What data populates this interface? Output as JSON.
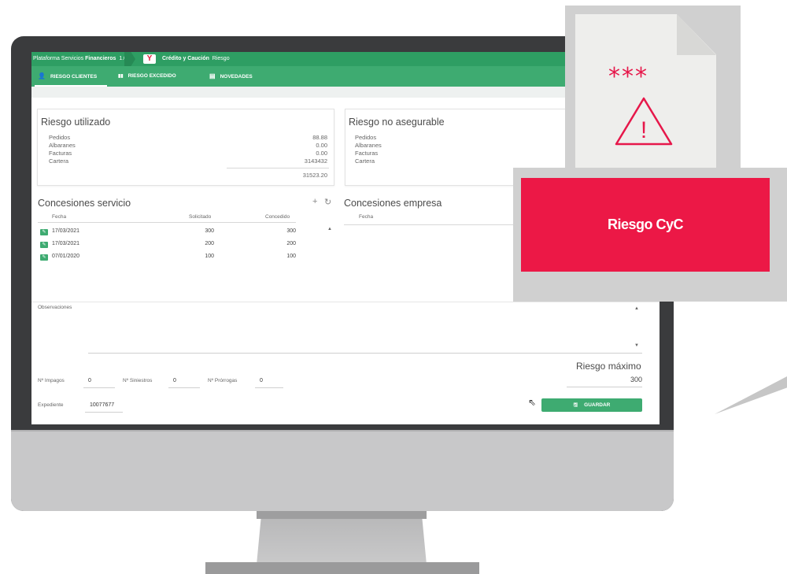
{
  "app": {
    "platform_name": "Plataforma Servicios ",
    "platform_bold": "Financieros",
    "version": "1.0",
    "breadcrumb_bold": "Crédito y Caución",
    "breadcrumb_rest": "Riesgo",
    "logo_glyph": "Y"
  },
  "tabs": [
    {
      "label": "RIESGO CLIENTES",
      "icon": "user-icon",
      "glyph": "👤",
      "active": true
    },
    {
      "label": "RIESGO EXCEDIDO",
      "icon": "bar-chart-icon",
      "glyph": "▮▮",
      "active": false
    },
    {
      "label": "NOVEDADES",
      "icon": "document-icon",
      "glyph": "▤",
      "active": false
    }
  ],
  "riesgo_utilizado": {
    "title": "Riesgo utilizado",
    "rows": [
      {
        "label": "Pedidos",
        "value": "88.88"
      },
      {
        "label": "Albaranes",
        "value": "0.00"
      },
      {
        "label": "Facturas",
        "value": "0.00"
      },
      {
        "label": "Cartera",
        "value": "3143432"
      }
    ],
    "total": "31523.20"
  },
  "riesgo_no_asegurable": {
    "title": "Riesgo no asegurable",
    "rows": [
      {
        "label": "Pedidos"
      },
      {
        "label": "Albaranes"
      },
      {
        "label": "Facturas"
      },
      {
        "label": "Cartera"
      }
    ]
  },
  "concesiones_servicio": {
    "title": "Concesiones servicio",
    "headers": {
      "fecha": "Fecha",
      "solicitado": "Solicitado",
      "concedido": "Concedido"
    },
    "rows": [
      {
        "fecha": "17/03/2021",
        "solicitado": "300",
        "concedido": "300"
      },
      {
        "fecha": "17/03/2021",
        "solicitado": "200",
        "concedido": "200"
      },
      {
        "fecha": "07/01/2020",
        "solicitado": "100",
        "concedido": "100"
      }
    ],
    "add_glyph": "+",
    "refresh_glyph": "↻",
    "scroll_up_glyph": "▲"
  },
  "concesiones_empresa": {
    "title": "Concesiones empresa",
    "headers": {
      "fecha": "Fecha"
    }
  },
  "observaciones": {
    "label": "Observaciones",
    "scroll_up_glyph": "▲",
    "scroll_down_glyph": "▼"
  },
  "counters": {
    "impagos_label": "Nº Impagos",
    "impagos": "0",
    "siniestros_label": "Nº Siniestros",
    "siniestros": "0",
    "prorrogas_label": "Nº Prórrogas",
    "prorrogas": "0"
  },
  "expediente": {
    "label": "Expediente",
    "value": "10077677"
  },
  "riesgo_maximo": {
    "label": "Riesgo máximo",
    "value": "300"
  },
  "save_button": {
    "label": "GUARDAR",
    "glyph": "🖫"
  },
  "overlay": {
    "stars": "***",
    "warning_glyph": "!",
    "label": "Riesgo CyC"
  },
  "colors": {
    "brand_green": "#2e9e63",
    "tab_green": "#3eab71",
    "alert_red": "#ec1846"
  }
}
